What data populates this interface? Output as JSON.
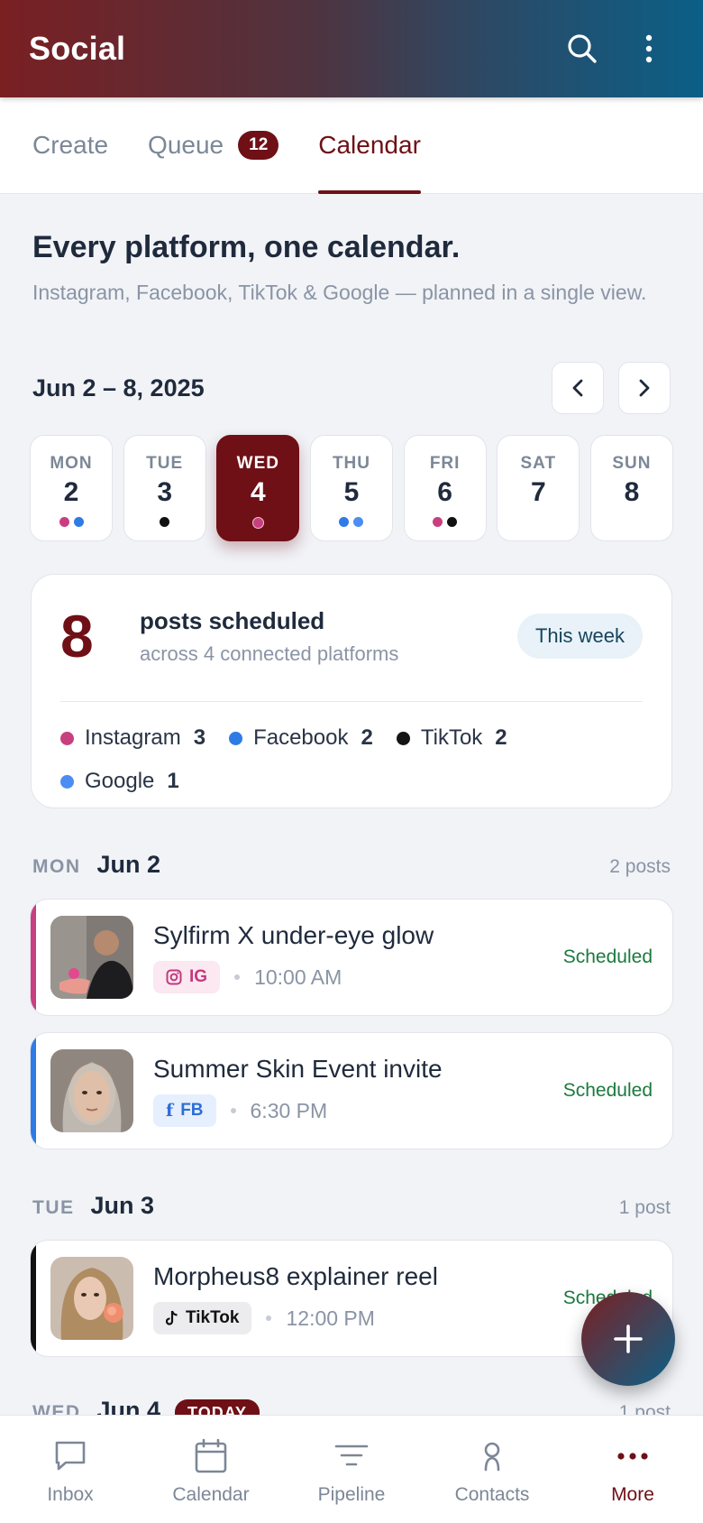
{
  "app": {
    "title": "Social"
  },
  "tabs": [
    {
      "label": "Create"
    },
    {
      "label": "Queue",
      "badge": "12"
    },
    {
      "label": "Calendar",
      "active": true
    }
  ],
  "hero": {
    "title": "Every platform, one calendar.",
    "subtitle": "Instagram, Facebook, TikTok & Google — planned in a single view."
  },
  "week": {
    "range": "Jun 2 – 8, 2025",
    "days": [
      {
        "name": "MON",
        "date": "2",
        "dots": [
          "#c83f80",
          "#2f7be6"
        ]
      },
      {
        "name": "TUE",
        "date": "3",
        "dots": [
          "#111111"
        ]
      },
      {
        "name": "WED",
        "date": "4",
        "dots": [
          "#c83f80"
        ],
        "active": true
      },
      {
        "name": "THU",
        "date": "5",
        "dots": [
          "#2f7be6",
          "#4b8df2"
        ]
      },
      {
        "name": "FRI",
        "date": "6",
        "dots": [
          "#c83f80",
          "#111111"
        ]
      },
      {
        "name": "SAT",
        "date": "7",
        "dots": []
      },
      {
        "name": "SUN",
        "date": "8",
        "dots": []
      }
    ]
  },
  "summary": {
    "count": "8",
    "title": "posts scheduled",
    "subtitle": "across 4 connected platforms",
    "pill": "This week",
    "platforms": [
      {
        "name": "Instagram",
        "count": "3",
        "color": "#c83f80"
      },
      {
        "name": "Facebook",
        "count": "2",
        "color": "#2f7be6"
      },
      {
        "name": "TikTok",
        "count": "2",
        "color": "#151515"
      },
      {
        "name": "Google",
        "count": "1",
        "color": "#4b8df2"
      }
    ]
  },
  "groups": [
    {
      "weekday": "MON",
      "date": "Jun 2",
      "count": "2 posts"
    },
    {
      "weekday": "TUE",
      "date": "Jun 3",
      "count": "1 post"
    },
    {
      "weekday": "WED",
      "date": "Jun 4",
      "count": "1 post",
      "badge": "TODAY"
    }
  ],
  "posts": [
    {
      "title": "Sylfirm X under-eye glow",
      "platform": "IG",
      "time": "10:00 AM",
      "status": "Scheduled",
      "stripe": "#c83f80"
    },
    {
      "title": "Summer Skin Event invite",
      "platform": "FB",
      "time": "6:30 PM",
      "status": "Scheduled",
      "stripe": "#2f7be6"
    },
    {
      "title": "Morpheus8 explainer reel",
      "platform": "TikTok",
      "time": "12:00 PM",
      "status": "Scheduled",
      "stripe": "#111111"
    }
  ],
  "bottom_nav": [
    {
      "label": "Inbox",
      "icon": "chat-icon"
    },
    {
      "label": "Calendar",
      "icon": "calendar-icon"
    },
    {
      "label": "Pipeline",
      "icon": "filter-icon"
    },
    {
      "label": "Contacts",
      "icon": "person-icon"
    },
    {
      "label": "More",
      "icon": "more-dots-icon",
      "active": true
    }
  ]
}
